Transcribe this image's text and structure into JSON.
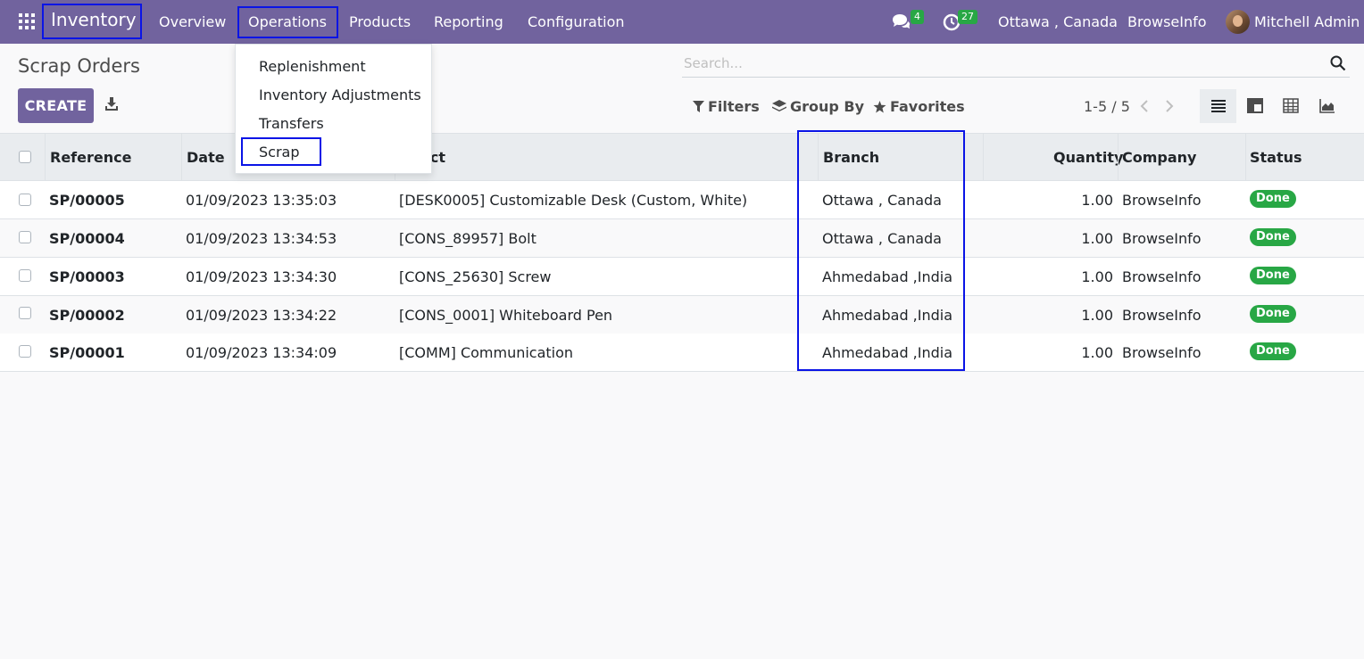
{
  "navbar": {
    "brand": "Inventory",
    "menu": [
      "Overview",
      "Operations",
      "Products",
      "Reporting",
      "Configuration"
    ],
    "messages_count": "4",
    "activities_count": "27",
    "branch": "Ottawa , Canada",
    "company": "BrowseInfo",
    "user": "Mitchell Admin"
  },
  "operations_menu": [
    "Replenishment",
    "Inventory Adjustments",
    "Transfers",
    "Scrap"
  ],
  "control_panel": {
    "title": "Scrap Orders",
    "create_label": "CREATE",
    "search_placeholder": "Search...",
    "filters": "Filters",
    "group_by": "Group By",
    "favorites": "Favorites",
    "pager": "1-5 / 5"
  },
  "table": {
    "columns": [
      "Reference",
      "Date",
      "Product",
      "Branch",
      "Quantity",
      "Company",
      "Status"
    ],
    "product_header_visible": "oduct",
    "rows": [
      {
        "reference": "SP/00005",
        "date": "01/09/2023 13:35:03",
        "product": "[DESK0005] Customizable Desk (Custom, White)",
        "branch": "Ottawa , Canada",
        "quantity": "1.00",
        "company": "BrowseInfo",
        "status": "Done"
      },
      {
        "reference": "SP/00004",
        "date": "01/09/2023 13:34:53",
        "product": "[CONS_89957] Bolt",
        "branch": "Ottawa , Canada",
        "quantity": "1.00",
        "company": "BrowseInfo",
        "status": "Done"
      },
      {
        "reference": "SP/00003",
        "date": "01/09/2023 13:34:30",
        "product": "[CONS_25630] Screw",
        "branch": "Ahmedabad ,India",
        "quantity": "1.00",
        "company": "BrowseInfo",
        "status": "Done"
      },
      {
        "reference": "SP/00002",
        "date": "01/09/2023 13:34:22",
        "product": "[CONS_0001] Whiteboard Pen",
        "branch": "Ahmedabad ,India",
        "quantity": "1.00",
        "company": "BrowseInfo",
        "status": "Done"
      },
      {
        "reference": "SP/00001",
        "date": "01/09/2023 13:34:09",
        "product": "[COMM] Communication",
        "branch": "Ahmedabad ,India",
        "quantity": "1.00",
        "company": "BrowseInfo",
        "status": "Done"
      }
    ]
  },
  "colors": {
    "brand": "#71639e",
    "highlight": "#0a14e6",
    "success": "#28a745"
  }
}
